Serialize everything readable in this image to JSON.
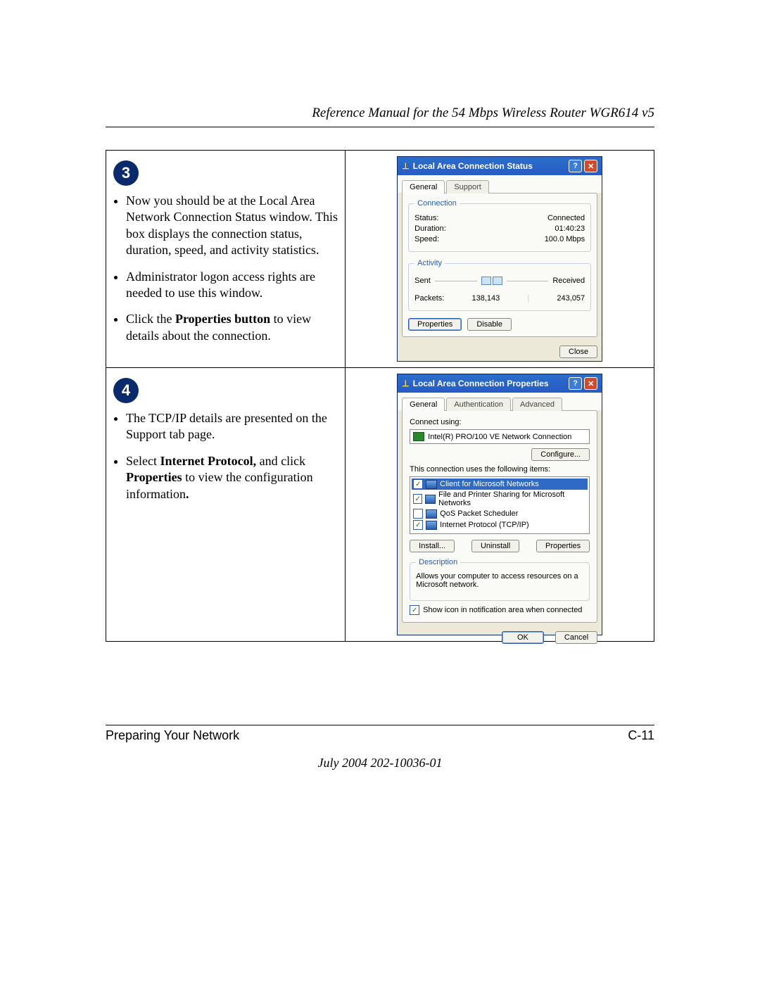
{
  "header": {
    "title": "Reference Manual for the 54 Mbps Wireless Router WGR614 v5"
  },
  "steps": {
    "3": {
      "badge": "3",
      "b1a": "Now you should be at the Local Area Network Connection Status window. This box displays the connection status, duration, speed, and activity statistics.",
      "b2": "Administrator logon access rights are needed to use this window.",
      "b3_pre": "Click the ",
      "b3_bold": "Properties button",
      "b3_post": " to view details about the connection."
    },
    "4": {
      "badge": "4",
      "b1": "The TCP/IP details are presented on the Support tab page.",
      "b2_pre": "Select ",
      "b2_bold1": "Internet Protocol,",
      "b2_mid": " and click ",
      "b2_bold2": "Properties",
      "b2_post": " to view the configuration information",
      "b2_dot": "."
    }
  },
  "statusWin": {
    "title": "Local Area Connection Status",
    "help": "?",
    "close": "✕",
    "tabGeneral": "General",
    "tabSupport": "Support",
    "grpConn": "Connection",
    "statusL": "Status:",
    "statusV": "Connected",
    "durationL": "Duration:",
    "durationV": "01:40:23",
    "speedL": "Speed:",
    "speedV": "100.0 Mbps",
    "grpAct": "Activity",
    "sent": "Sent",
    "received": "Received",
    "packetsL": "Packets:",
    "sentV": "138,143",
    "recvV": "243,057",
    "btnProps": "Properties",
    "btnDisable": "Disable",
    "btnClose": "Close"
  },
  "propsWin": {
    "title": "Local Area Connection Properties",
    "help": "?",
    "close": "✕",
    "tabGeneral": "General",
    "tabAuth": "Authentication",
    "tabAdv": "Advanced",
    "connectUsing": "Connect using:",
    "adapter": "Intel(R) PRO/100 VE Network Connection",
    "btnConfigure": "Configure...",
    "usesItems": "This connection uses the following items:",
    "items": {
      "client": "Client for Microsoft Networks",
      "fileprint": "File and Printer Sharing for Microsoft Networks",
      "qos": "QoS Packet Scheduler",
      "tcpip": "Internet Protocol (TCP/IP)"
    },
    "checks": {
      "client": "✓",
      "fileprint": "✓",
      "qos": "",
      "tcpip": "✓"
    },
    "btnInstall": "Install...",
    "btnUninstall": "Uninstall",
    "btnProps": "Properties",
    "grpDesc": "Description",
    "descText": "Allows your computer to access resources on a Microsoft network.",
    "showIconCheck": "✓",
    "showIcon": "Show icon in notification area when connected",
    "btnOK": "OK",
    "btnCancel": "Cancel"
  },
  "footer": {
    "left": "Preparing Your Network",
    "right": "C-11",
    "date": "July 2004 202-10036-01"
  }
}
